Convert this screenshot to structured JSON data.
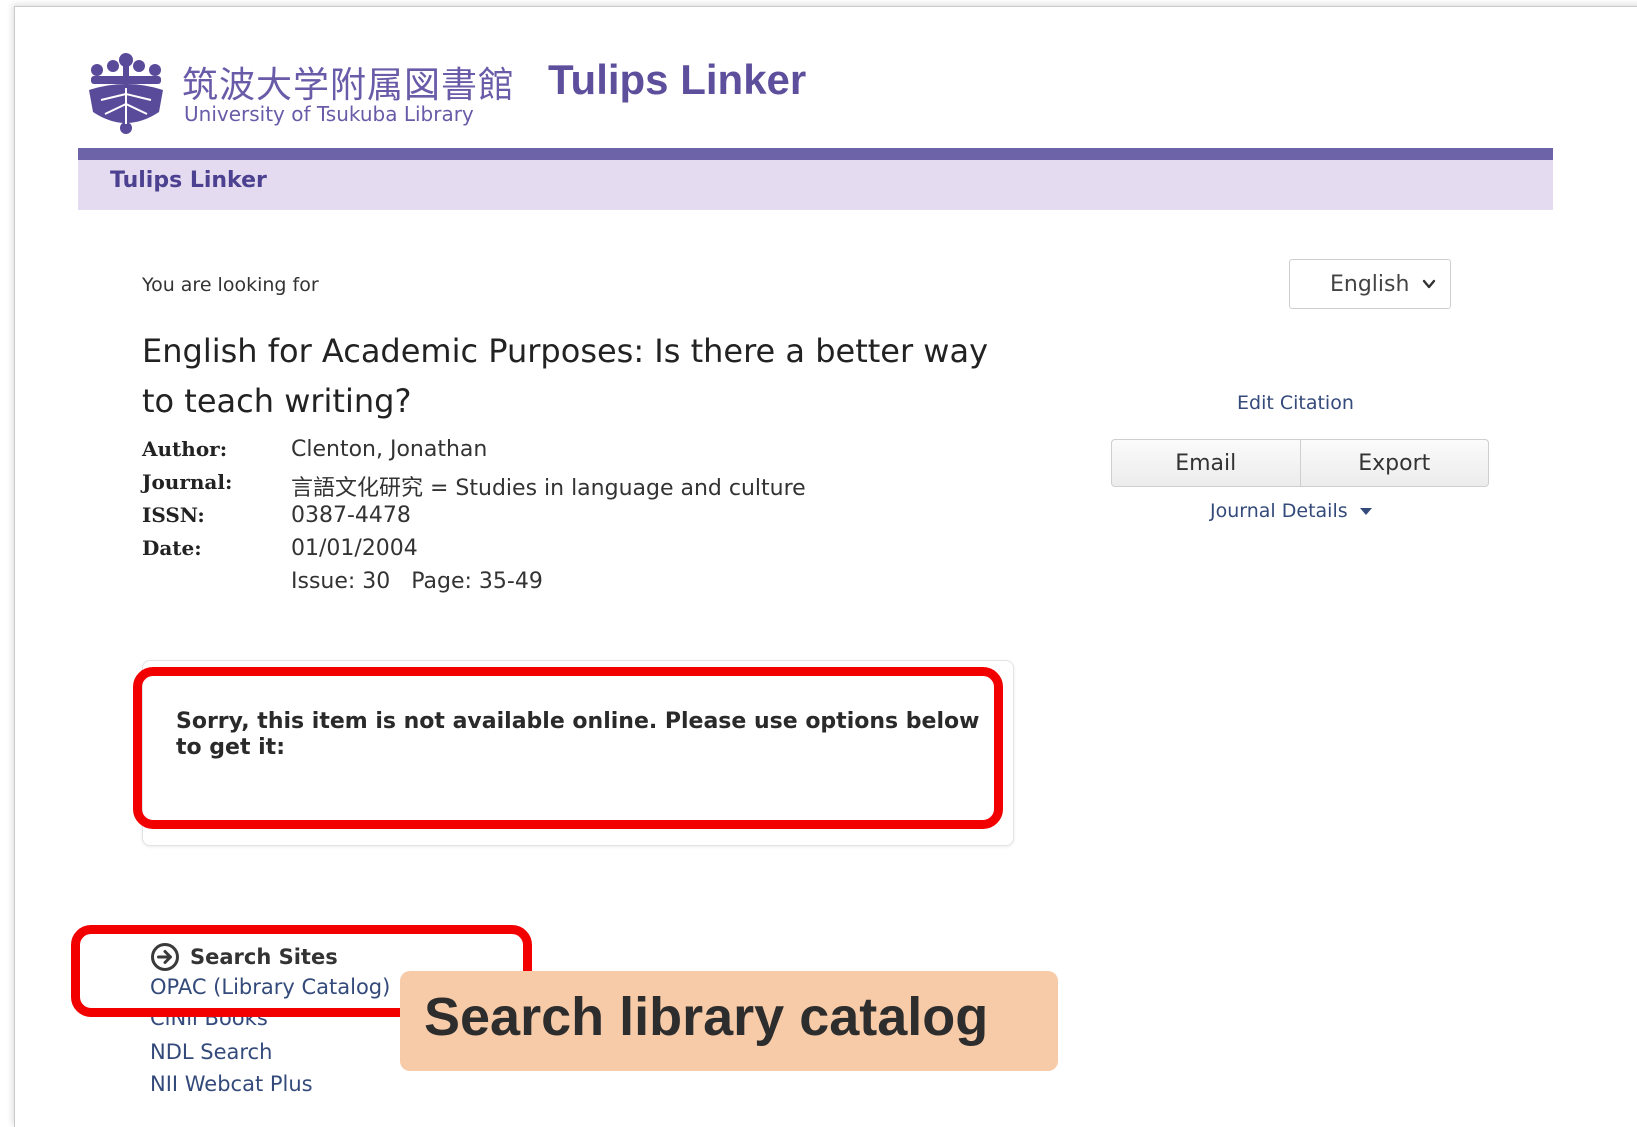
{
  "header": {
    "logo_jp": "筑波大学附属図書館",
    "logo_en": "University of Tsukuba Library",
    "app_title": "Tulips Linker",
    "nav_label": "Tulips Linker"
  },
  "language_select": {
    "selected": "English"
  },
  "citation": {
    "intro": "You are looking for",
    "title": "English for Academic Purposes: Is there a better way to teach writing?",
    "author_label": "Author:",
    "author": "Clenton, Jonathan",
    "journal_label": "Journal:",
    "journal": "言語文化研究 = Studies in language and culture",
    "issn_label": "ISSN:",
    "issn": "0387-4478",
    "date_label": "Date:",
    "date": "01/01/2004",
    "issue_page": "Issue: 30   Page: 35-49"
  },
  "actions": {
    "edit_citation": "Edit Citation",
    "email": "Email",
    "export": "Export",
    "journal_details": "Journal Details"
  },
  "availability": {
    "message": "Sorry, this item is not available online. Please use options below to get it:"
  },
  "search_sites": {
    "heading": "Search Sites",
    "links": [
      "OPAC (Library Catalog)",
      "CiNii Books",
      "NDL Search",
      "NII Webcat Plus"
    ]
  },
  "annotation": {
    "callout": "Search library catalog",
    "highlight_color": "#f20000",
    "callout_color": "#f7caa8"
  },
  "colors": {
    "brand_purple": "#6d63a8",
    "nav_background": "#e4dbf0",
    "link": "#334a7a"
  }
}
